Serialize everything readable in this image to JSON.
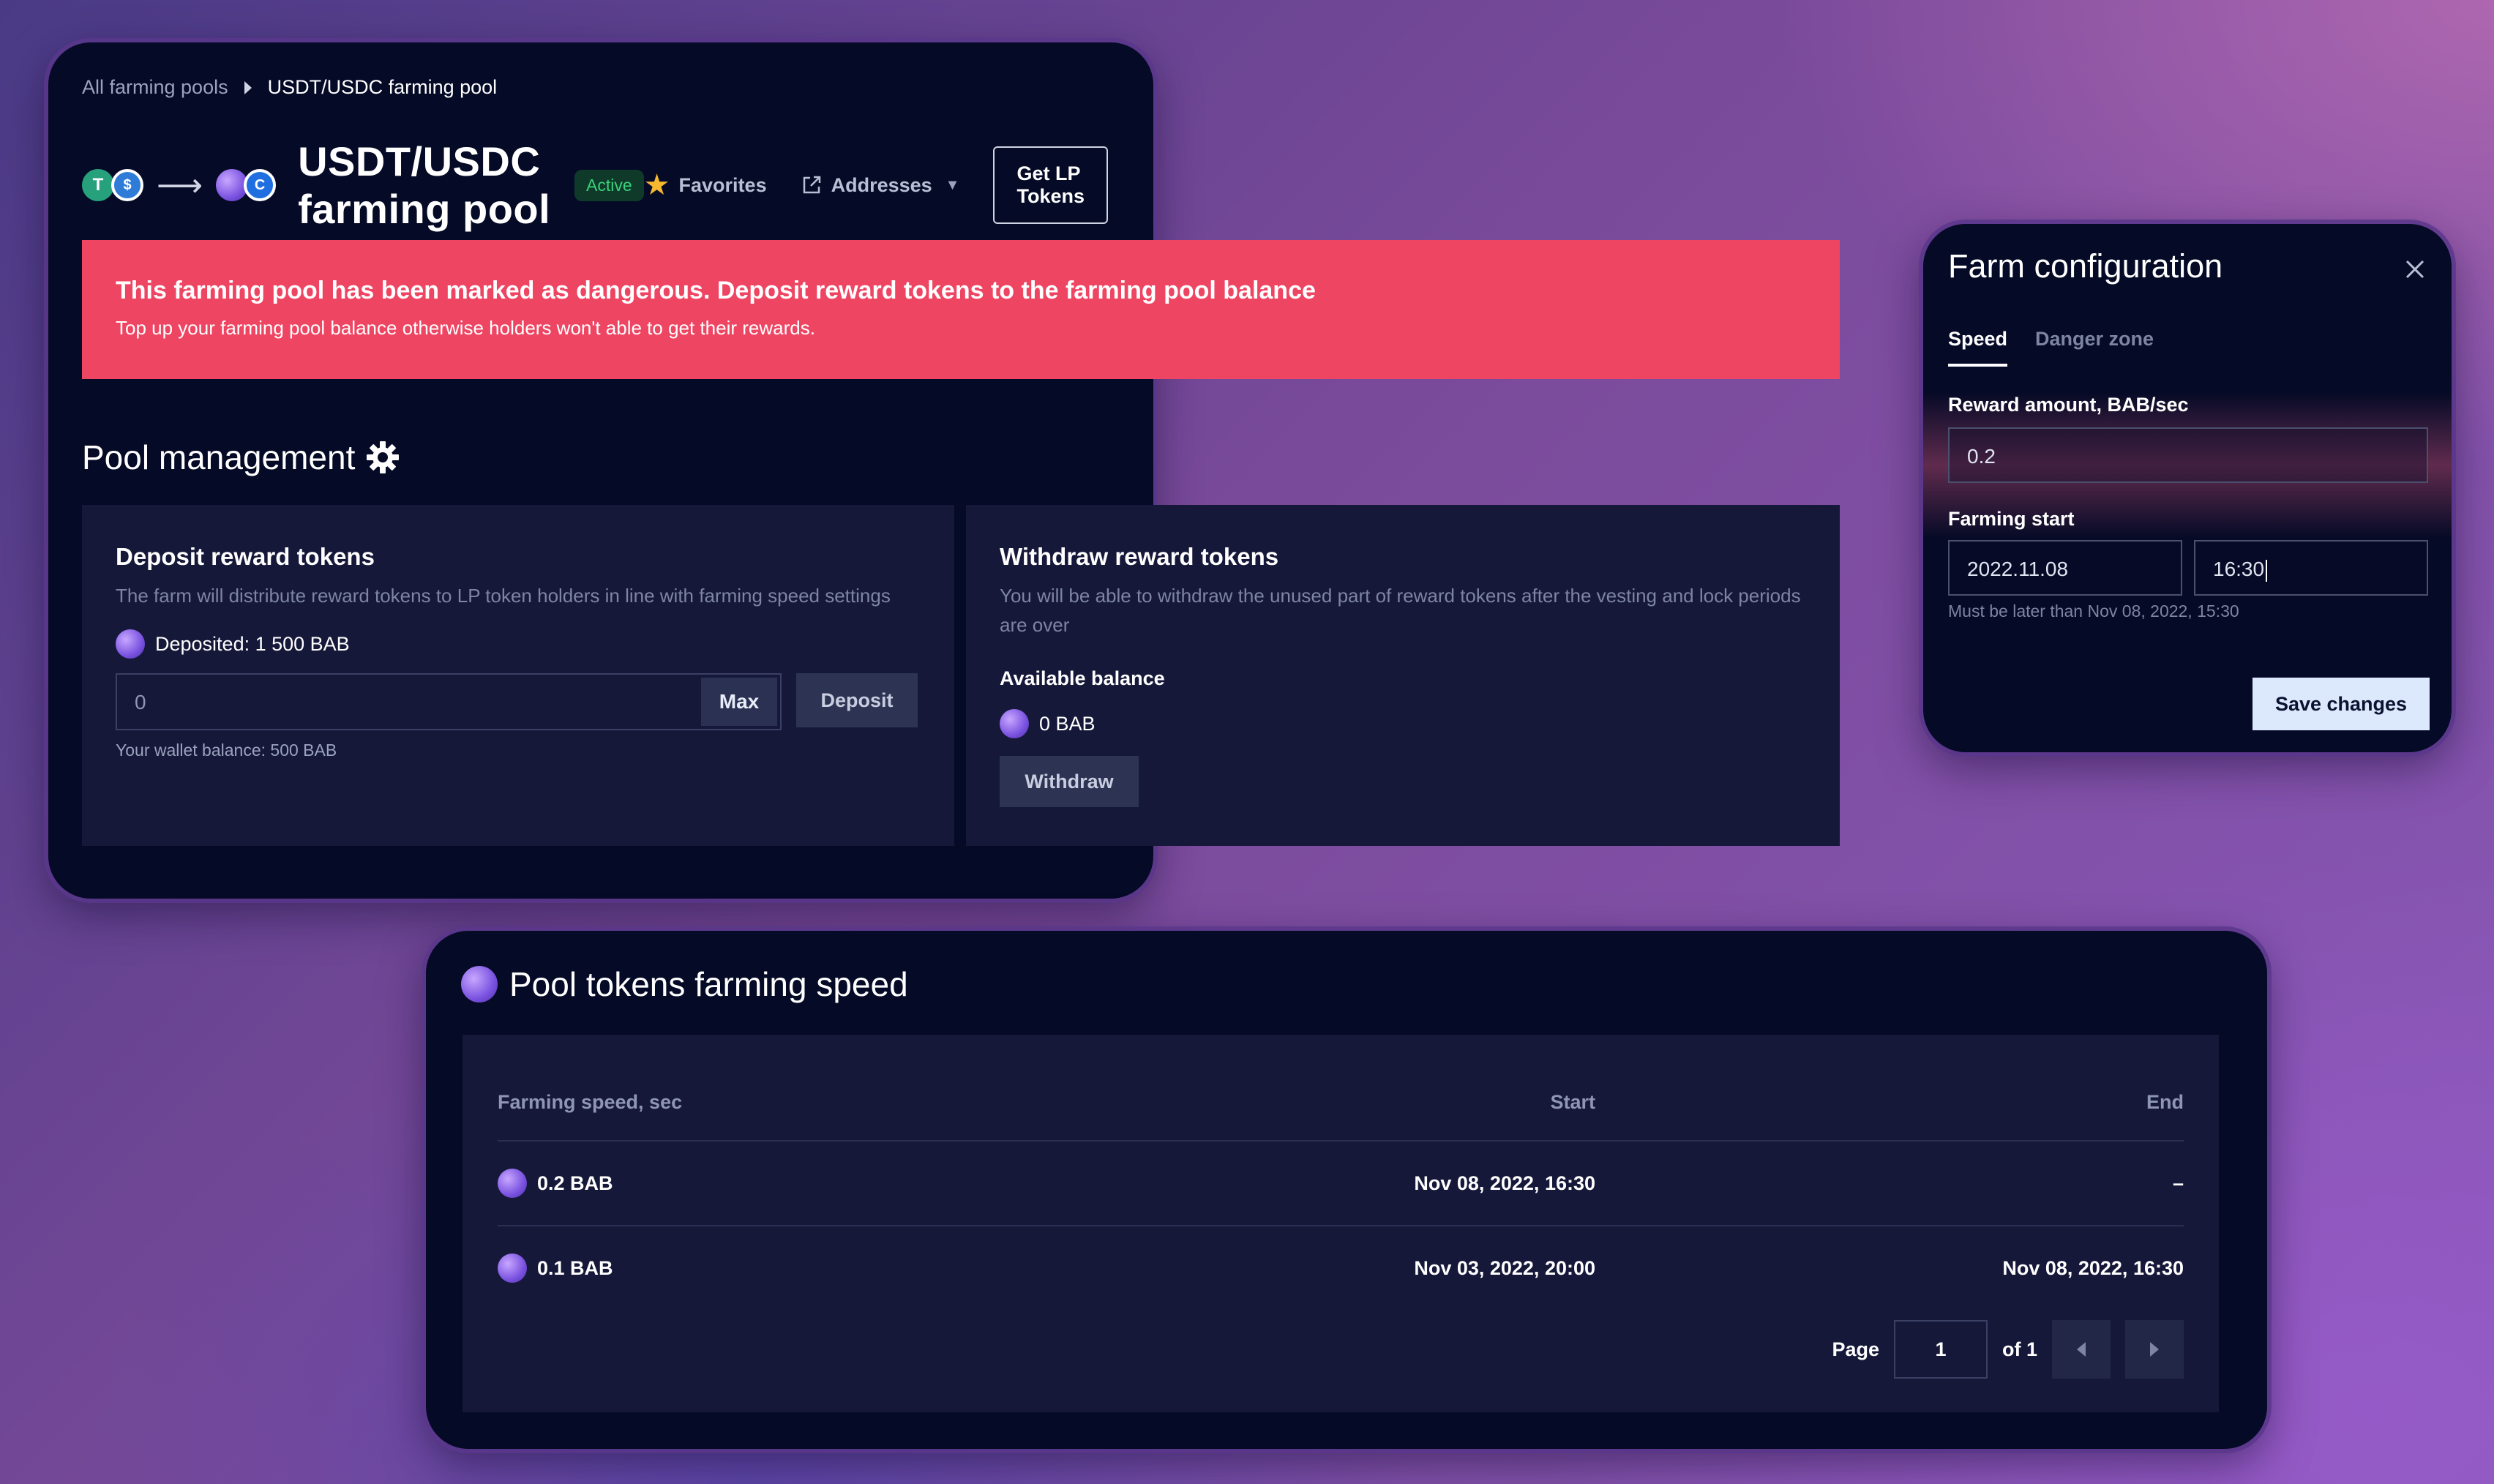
{
  "breadcrumb": {
    "parent": "All farming pools",
    "current": "USDT/USDC farming pool"
  },
  "pool": {
    "title": "USDT/USDC farming pool",
    "status": "Active"
  },
  "header_actions": {
    "favorites": "Favorites",
    "addresses": "Addresses",
    "get_lp": "Get LP Tokens"
  },
  "alert": {
    "title": "This farming pool has been marked as dangerous. Deposit reward tokens to the farming pool balance",
    "text": "Top up your farming pool balance otherwise holders won't able to get their rewards."
  },
  "management": {
    "title": "Pool management",
    "deposit": {
      "title": "Deposit reward tokens",
      "description": "The farm will distribute reward tokens to LP token holders in line with farming speed settings",
      "deposited": "Deposited: 1 500 BAB",
      "amount_value": "0",
      "max_label": "Max",
      "button_label": "Deposit",
      "wallet_balance": "Your wallet balance: 500 BAB"
    },
    "withdraw": {
      "title": "Withdraw reward tokens",
      "description": "You will be able to withdraw the unused part of reward tokens after the vesting and lock periods are over",
      "available_label": "Available balance",
      "available_value": "0 BAB",
      "button_label": "Withdraw"
    }
  },
  "config": {
    "title": "Farm configuration",
    "tabs": [
      {
        "label": "Speed"
      },
      {
        "label": "Danger zone"
      }
    ],
    "reward_label": "Reward amount, BAB/sec",
    "reward_value": "0.2",
    "start_label": "Farming start",
    "start_date": "2022.11.08",
    "start_time": "16:30",
    "hint": "Must be later than Nov 08, 2022, 15:30",
    "save_label": "Save changes"
  },
  "speed_table": {
    "title": "Pool tokens farming speed",
    "columns": [
      "Farming speed, sec",
      "Start",
      "End"
    ],
    "rows": [
      {
        "speed": "0.2 BAB",
        "start": "Nov 08, 2022, 16:30",
        "end": "–"
      },
      {
        "speed": "0.1 BAB",
        "start": "Nov 03, 2022, 20:00",
        "end": "Nov 08, 2022, 16:30"
      }
    ],
    "pager": {
      "page_label": "Page",
      "page": "1",
      "of_label": "of 1"
    }
  },
  "icons": {
    "star": "star-icon",
    "external": "external-link-icon",
    "gear": "gear-icon",
    "close": "close-icon",
    "token": "bab-token-icon"
  },
  "colors": {
    "danger": "#ee4563",
    "active_badge": "#3ad27a",
    "panel_bg": "#050a26",
    "card_bg": "#16183a",
    "primary_button": "#dce8fb"
  }
}
